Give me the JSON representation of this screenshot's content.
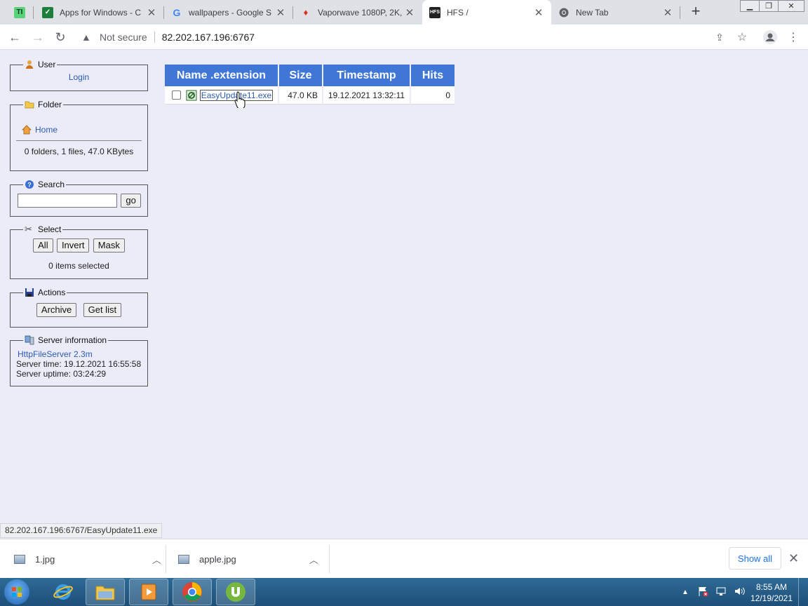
{
  "browser": {
    "tabs": [
      {
        "title": "Apps for Windows - C",
        "icon": "green-app-icon"
      },
      {
        "title": "wallpapers - Google S",
        "icon": "google-g-icon"
      },
      {
        "title": "Vaporwave 1080P, 2K,",
        "icon": "flame-icon"
      },
      {
        "title": "HFS /",
        "icon": "hfs-icon"
      },
      {
        "title": "New Tab",
        "icon": "chrome-icon"
      }
    ],
    "omnibox": {
      "security_label": "Not secure",
      "url": "82.202.167.196:6767"
    }
  },
  "sidebar": {
    "user": {
      "legend": "User",
      "login_link": "Login"
    },
    "folder": {
      "legend": "Folder",
      "home_link": "Home",
      "summary": "0 folders, 1 files, 47.0 KBytes"
    },
    "search": {
      "legend": "Search",
      "go_label": "go"
    },
    "select": {
      "legend": "Select",
      "all_label": "All",
      "invert_label": "Invert",
      "mask_label": "Mask",
      "selected_text": "0 items selected"
    },
    "actions": {
      "legend": "Actions",
      "archive_label": "Archive",
      "getlist_label": "Get list"
    },
    "server": {
      "legend": "Server information",
      "version_link": "HttpFileServer 2.3m",
      "time_text": "Server time: 19.12.2021 16:55:58",
      "uptime_text": "Server uptime: 03:24:29"
    }
  },
  "files": {
    "headers": {
      "name": "Name .extension",
      "size": "Size",
      "timestamp": "Timestamp",
      "hits": "Hits"
    },
    "rows": [
      {
        "name": "EasyUpdate11.exe",
        "size": "47.0 KB",
        "timestamp": "19.12.2021 13:32:11",
        "hits": "0"
      }
    ]
  },
  "status_url": "82.202.167.196:6767/EasyUpdate11.exe",
  "downloads": {
    "items": [
      {
        "name": "1.jpg"
      },
      {
        "name": "apple.jpg"
      }
    ],
    "show_all_label": "Show all"
  },
  "taskbar": {
    "time": "8:55 AM",
    "date": "12/19/2021"
  }
}
